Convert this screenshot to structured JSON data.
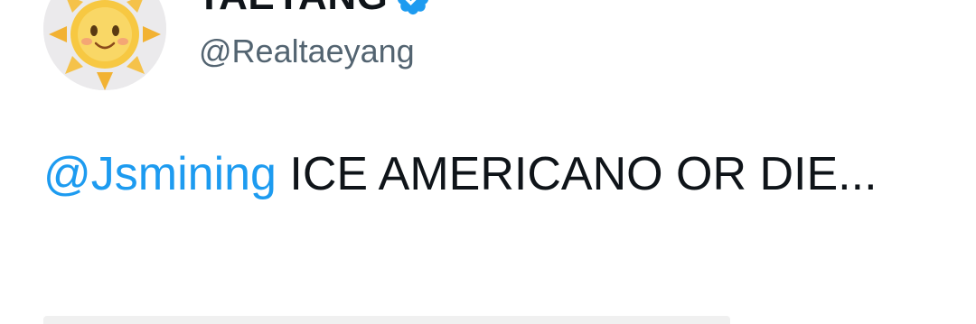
{
  "author": {
    "display_name": "TAEYANG",
    "handle": "@Realtaeyang",
    "verified": true,
    "avatar_icon": "sun-avatar-icon"
  },
  "tweet": {
    "mention": "@Jsmining",
    "text": "ICE AMERICANO OR DIE..."
  },
  "colors": {
    "mention": "#1d9bf0",
    "handle": "#536471",
    "text": "#0f1419",
    "verified_badge": "#1d9bf0"
  },
  "icons": {
    "verified": "verified-badge-icon",
    "more": "more-options-icon"
  }
}
